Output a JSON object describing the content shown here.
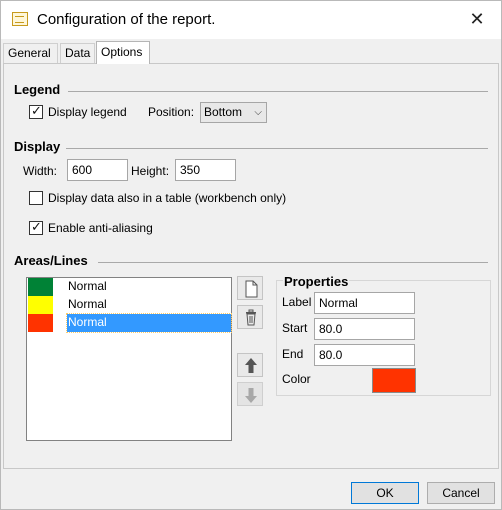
{
  "window": {
    "title": "Configuration of the report.",
    "close_glyph": "✕"
  },
  "tabs": [
    {
      "label": "General"
    },
    {
      "label": "Data"
    },
    {
      "label": "Options"
    }
  ],
  "active_tab": "Options",
  "legend": {
    "title": "Legend",
    "display_label": "Display legend",
    "display_checked": true,
    "position_label": "Position:",
    "position_value": "Bottom"
  },
  "display": {
    "title": "Display",
    "width_label": "Width:",
    "width_value": "600",
    "height_label": "Height:",
    "height_value": "350",
    "table_label": "Display data also in a table (workbench only)",
    "table_checked": false,
    "aa_label": "Enable anti-aliasing",
    "aa_checked": true
  },
  "areas": {
    "title": "Areas/Lines",
    "items": [
      {
        "label": "Normal",
        "color": "#008236",
        "selected": false
      },
      {
        "label": "Normal",
        "color": "#ffff00",
        "selected": false
      },
      {
        "label": "Normal",
        "color": "#ff3300",
        "selected": true
      }
    ],
    "tools": [
      "new-document-icon",
      "trash-icon",
      "arrow-up-icon",
      "arrow-down-icon"
    ]
  },
  "properties": {
    "title": "Properties",
    "label_label": "Label",
    "label_value": "Normal",
    "start_label": "Start",
    "start_value": "80.0",
    "end_label": "End",
    "end_value": "80.0",
    "color_label": "Color",
    "color_value": "#ff3300"
  },
  "footer": {
    "ok_label": "OK",
    "cancel_label": "Cancel"
  }
}
